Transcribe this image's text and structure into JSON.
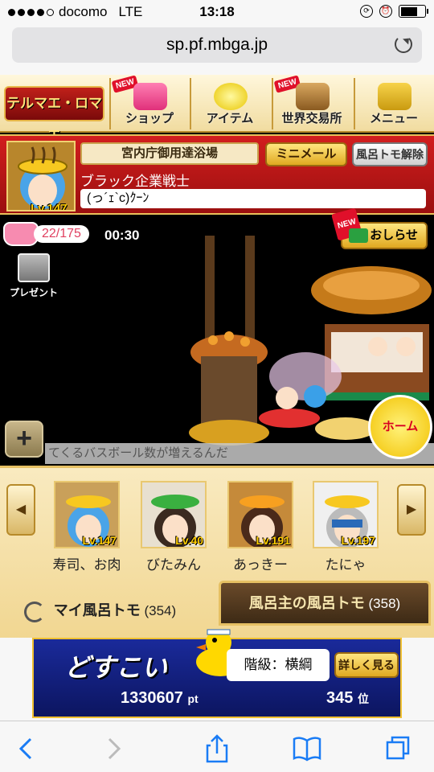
{
  "status_bar": {
    "carrier": "docomo",
    "network": "LTE",
    "time": "13:18"
  },
  "url_bar": {
    "domain": "sp.pf.mbga.jp"
  },
  "top_menu": {
    "logo_text": "テルマエ・ロマエ",
    "items": [
      {
        "label": "ショップ",
        "new_badge": "NEW"
      },
      {
        "label": "アイテム"
      },
      {
        "label": "世界交易所",
        "new_badge": "NEW"
      },
      {
        "label": "メニュー"
      }
    ]
  },
  "profile": {
    "level": "Lv.147",
    "bath_name": "宮内庁御用達浴場",
    "mini_mail_label": "ミニメール",
    "unfriend_label": "風呂トモ解除",
    "title": "ブラック企業戦士",
    "status_message": "(っ´ｪ`c)ｸｰﾝ"
  },
  "stamina": {
    "value": "22/175",
    "timer": "00:30"
  },
  "notice": {
    "new_badge": "NEW",
    "label": "おしらせ"
  },
  "present": {
    "label": "プレゼント"
  },
  "ticker": {
    "text": "てくるバスボール数が増えるんだ"
  },
  "home_button": {
    "label": "ホーム"
  },
  "friends": {
    "list": [
      {
        "name": "寿司、お肉",
        "level": "Lv.147"
      },
      {
        "name": "びたみん",
        "level": "Lv.40"
      },
      {
        "name": "あっきー",
        "level": "Lv.191"
      },
      {
        "name": "たにゃ",
        "level": "Lv.197"
      }
    ],
    "my_friends_label": "マイ風呂トモ",
    "my_friends_count": "(354)",
    "bath_owner_label": "風呂主の風呂トモ",
    "bath_owner_count": "(358)"
  },
  "banner": {
    "title": "どすこい",
    "rank_label": "階級：横綱",
    "detail_button": "詳しく見る",
    "points": "1330607",
    "points_unit": "pt",
    "rank_position": "345",
    "rank_unit": "位"
  },
  "colors": {
    "accent_red": "#c0201a",
    "gold": "#e6c063",
    "ios_blue": "#1a7cf5"
  }
}
